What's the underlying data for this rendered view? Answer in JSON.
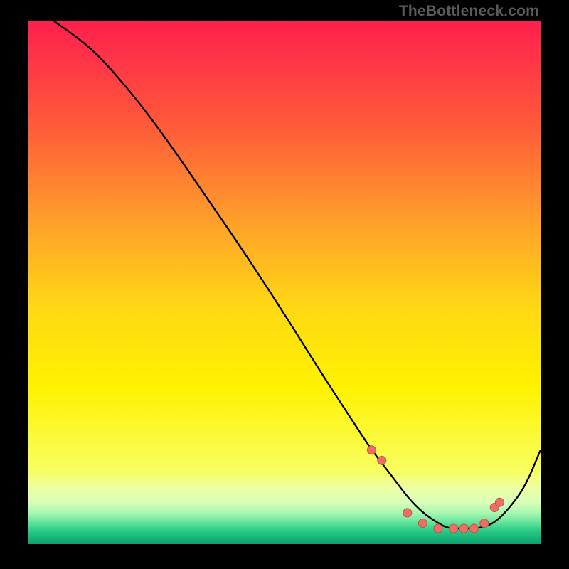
{
  "watermark": "TheBottleneck.com",
  "chart_data": {
    "type": "line",
    "title": "",
    "xlabel": "",
    "ylabel": "",
    "xlim": [
      0,
      100
    ],
    "ylim": [
      0,
      100
    ],
    "grid": false,
    "legend": false,
    "background_gradient": {
      "stops": [
        {
          "pos": 0.0,
          "color": "#ff1f4e"
        },
        {
          "pos": 0.2,
          "color": "#ff5a3a"
        },
        {
          "pos": 0.4,
          "color": "#ffa628"
        },
        {
          "pos": 0.55,
          "color": "#ffd914"
        },
        {
          "pos": 0.7,
          "color": "#fff200"
        },
        {
          "pos": 0.86,
          "color": "#f8ff60"
        },
        {
          "pos": 0.89,
          "color": "#efffa0"
        },
        {
          "pos": 0.92,
          "color": "#d8ffb8"
        },
        {
          "pos": 0.94,
          "color": "#a8f7b0"
        },
        {
          "pos": 0.96,
          "color": "#5de29a"
        },
        {
          "pos": 0.975,
          "color": "#28c986"
        },
        {
          "pos": 1.0,
          "color": "#0aa06c"
        }
      ]
    },
    "series": [
      {
        "name": "bottleneck-curve",
        "x": [
          5,
          8,
          12,
          16,
          22,
          28,
          35,
          42,
          50,
          57,
          63,
          67,
          71,
          74,
          77,
          80,
          82,
          85,
          88,
          91,
          94,
          97,
          100
        ],
        "values": [
          100,
          98,
          95,
          91,
          84,
          76,
          66,
          56,
          44,
          33,
          24,
          18,
          13,
          9,
          6,
          4,
          3,
          3,
          3,
          4,
          7,
          11,
          18
        ]
      }
    ],
    "markers": {
      "name": "highlight-dots",
      "x": [
        67,
        69,
        74,
        77,
        80,
        83,
        85,
        87,
        89,
        91,
        92
      ],
      "values": [
        18,
        16,
        6,
        4,
        3,
        3,
        3,
        3,
        4,
        7,
        8
      ]
    }
  }
}
